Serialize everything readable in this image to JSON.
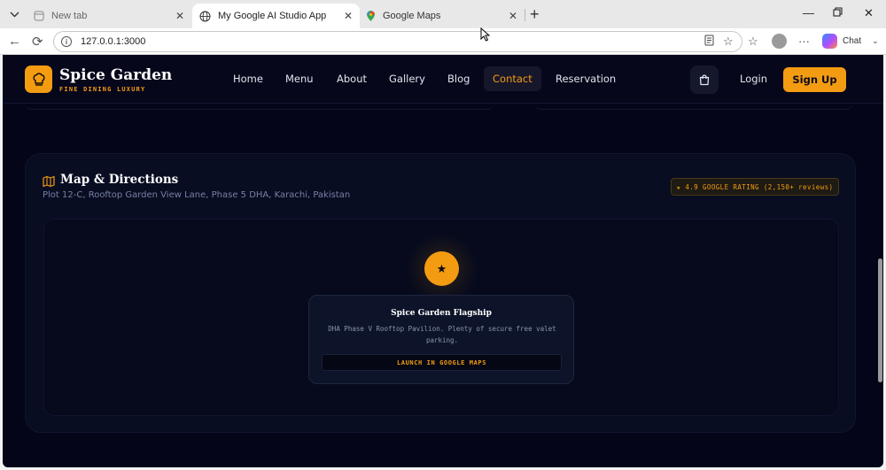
{
  "browser": {
    "tab_list_icon": "chevron-down-icon",
    "tabs": [
      {
        "title": "New tab",
        "icon": "page-icon",
        "active": false
      },
      {
        "title": "My Google AI Studio App",
        "icon": "globe-icon",
        "active": true
      },
      {
        "title": "Google Maps",
        "icon": "maps-pin-icon",
        "active": false
      }
    ],
    "url": "127.0.0.1:3000",
    "copilot_label": "Chat"
  },
  "site": {
    "brand_name": "Spice Garden",
    "brand_tagline": "FINE DINING LUXURY",
    "nav": [
      {
        "label": "Home",
        "active": false
      },
      {
        "label": "Menu",
        "active": false
      },
      {
        "label": "About",
        "active": false
      },
      {
        "label": "Gallery",
        "active": false
      },
      {
        "label": "Blog",
        "active": false
      },
      {
        "label": "Contact",
        "active": true
      },
      {
        "label": "Reservation",
        "active": false
      }
    ],
    "login_label": "Login",
    "signup_label": "Sign Up",
    "accent_color": "#f39c12"
  },
  "map_section": {
    "title": "Map & Directions",
    "address": "Plot 12-C, Rooftop Garden View Lane, Phase 5 DHA, Karachi, Pakistan",
    "rating_badge": "★ 4.9 GOOGLE RATING (2,150+ reviews)",
    "pin_glyph": "★",
    "info_card": {
      "title": "Spice Garden Flagship",
      "description": "DHA Phase V Rooftop Pavilion. Plenty of secure free valet parking.",
      "button_label": "LAUNCH IN GOOGLE MAPS"
    }
  }
}
